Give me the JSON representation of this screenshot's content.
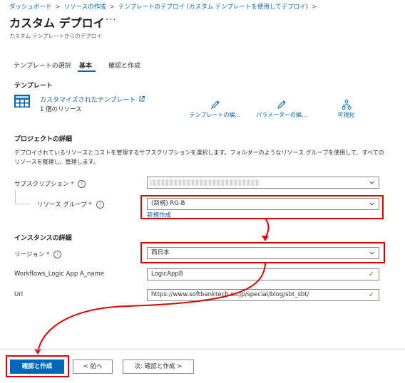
{
  "breadcrumb": [
    "ダッシュボード",
    "リソースの作成",
    "テンプレートのデプロイ (カスタム テンプレートを使用してデプロイ)"
  ],
  "header": {
    "title": "カスタム デプロイ",
    "more": "···",
    "subtitle": "カスタム テンプレートからのデプロイ"
  },
  "tabs": [
    "テンプレートの選択",
    "基本",
    "確認と作成"
  ],
  "template": {
    "heading": "テンプレート",
    "name": "カスタマイズされたテンプレート",
    "count": "1 個のリソース",
    "actions": [
      "テンプレートの編...",
      "パラメーターの編...",
      "可視化"
    ]
  },
  "project": {
    "heading": "プロジェクトの詳細",
    "description": "デプロイされているリソースとコストを管理するサブスクリプションを選択します。フォルダーのようなリソース グループを使用して、すべてのリソースを整理し、管理します。",
    "subscription_label": "サブスクリプション",
    "resource_group_label": "リソース グループ",
    "resource_group_value": "(新規) RG-B",
    "new_link": "新規作成"
  },
  "instance": {
    "heading": "インスタンスの詳細",
    "region_label": "リージョン",
    "region_value": "西日本",
    "workflow_label": "Workflows_Logic App A_name",
    "workflow_value": "LogicAppB",
    "url_label": "Url",
    "url_value": "https://www.softbanktech.co.jp/special/blog/sbt_sbt/"
  },
  "required_mark": "*",
  "info_glyph": "i",
  "footer": {
    "review_create": "確認と作成",
    "prev": "< 前へ",
    "next": "次: 確認と作成 >"
  },
  "colors": {
    "accent": "#0067b8",
    "highlight": "#e00000",
    "valid": "#57a300"
  }
}
